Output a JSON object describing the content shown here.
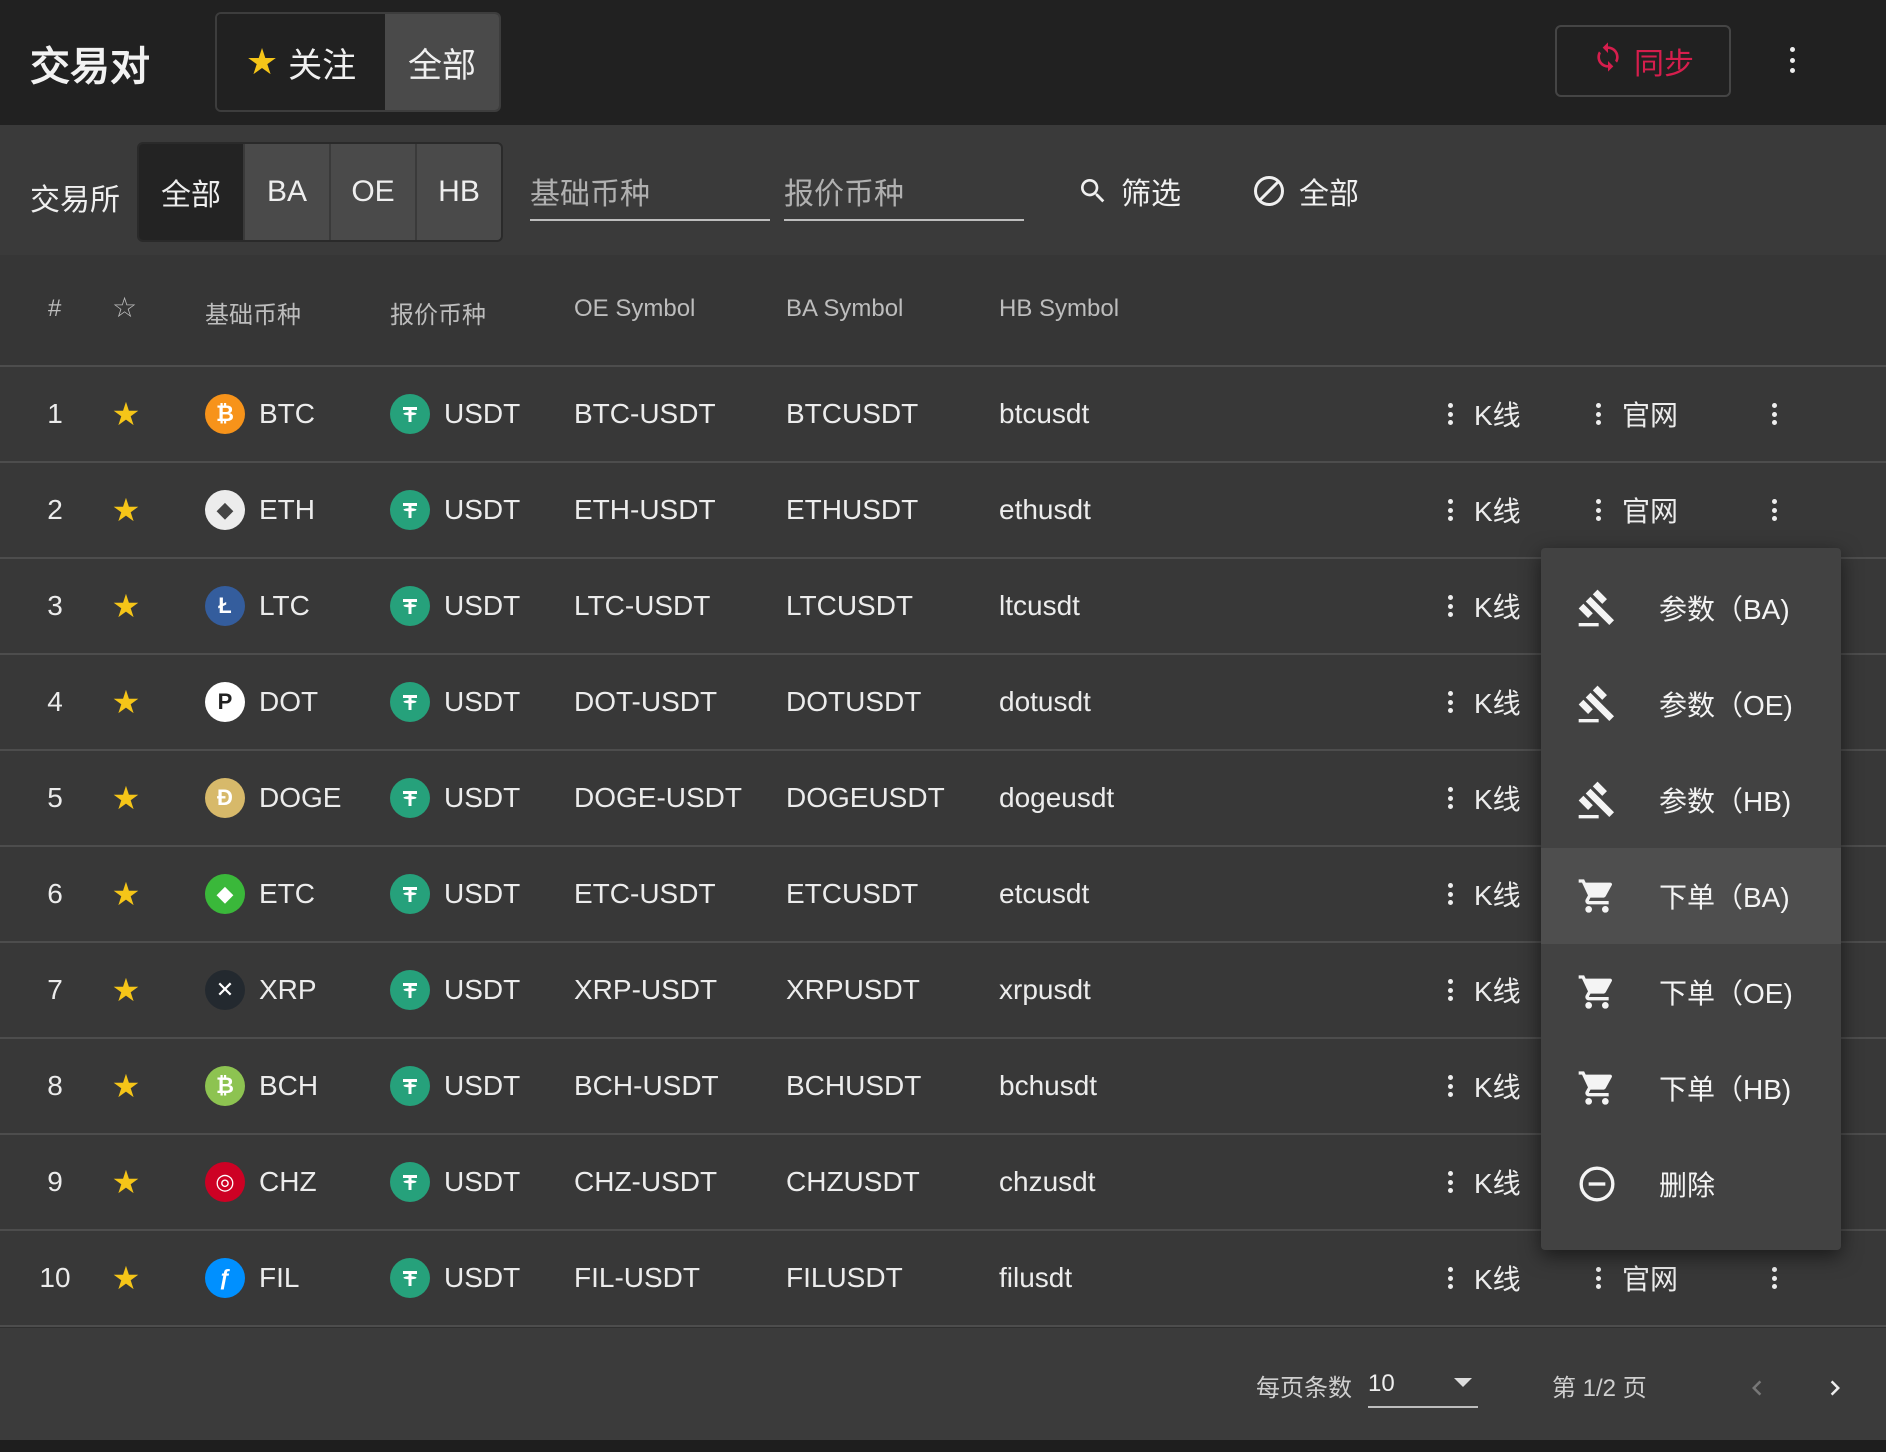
{
  "header": {
    "title": "交易对",
    "toggle_fav": "关注",
    "toggle_all": "全部",
    "sync_label": "同步"
  },
  "filters": {
    "exchange_label": "交易所",
    "exchanges": [
      "全部",
      "BA",
      "OE",
      "HB"
    ],
    "base_placeholder": "基础币种",
    "quote_placeholder": "报价币种",
    "filter_label": "筛选",
    "clear_label": "全部"
  },
  "table": {
    "columns": [
      "#",
      "☆",
      "基础币种",
      "报价币种",
      "OE Symbol",
      "BA Symbol",
      "HB Symbol"
    ],
    "kline_label": "K线",
    "site_label": "官网",
    "rows": [
      {
        "n": "1",
        "base": "BTC",
        "quote": "USDT",
        "oe": "BTC-USDT",
        "ba": "BTCUSDT",
        "hb": "btcusdt",
        "icon": "bitcoin-icon",
        "color": "#f7931a",
        "glyph": "₿"
      },
      {
        "n": "2",
        "base": "ETH",
        "quote": "USDT",
        "oe": "ETH-USDT",
        "ba": "ETHUSDT",
        "hb": "ethusdt",
        "icon": "ethereum-icon",
        "color": "#ececec",
        "glyph": "◆"
      },
      {
        "n": "3",
        "base": "LTC",
        "quote": "USDT",
        "oe": "LTC-USDT",
        "ba": "LTCUSDT",
        "hb": "ltcusdt",
        "icon": "litecoin-icon",
        "color": "#345d9d",
        "glyph": "Ł"
      },
      {
        "n": "4",
        "base": "DOT",
        "quote": "USDT",
        "oe": "DOT-USDT",
        "ba": "DOTUSDT",
        "hb": "dotusdt",
        "icon": "polkadot-icon",
        "color": "#ffffff",
        "glyph": "P"
      },
      {
        "n": "5",
        "base": "DOGE",
        "quote": "USDT",
        "oe": "DOGE-USDT",
        "ba": "DOGEUSDT",
        "hb": "dogeusdt",
        "icon": "dogecoin-icon",
        "color": "#d7b96a",
        "glyph": "Ð"
      },
      {
        "n": "6",
        "base": "ETC",
        "quote": "USDT",
        "oe": "ETC-USDT",
        "ba": "ETCUSDT",
        "hb": "etcusdt",
        "icon": "ethereum-classic-icon",
        "color": "#3ab83a",
        "glyph": "◆"
      },
      {
        "n": "7",
        "base": "XRP",
        "quote": "USDT",
        "oe": "XRP-USDT",
        "ba": "XRPUSDT",
        "hb": "xrpusdt",
        "icon": "ripple-icon",
        "color": "#23292f",
        "glyph": "✕"
      },
      {
        "n": "8",
        "base": "BCH",
        "quote": "USDT",
        "oe": "BCH-USDT",
        "ba": "BCHUSDT",
        "hb": "bchusdt",
        "icon": "bitcoin-cash-icon",
        "color": "#8dc351",
        "glyph": "₿"
      },
      {
        "n": "9",
        "base": "CHZ",
        "quote": "USDT",
        "oe": "CHZ-USDT",
        "ba": "CHZUSDT",
        "hb": "chzusdt",
        "icon": "chiliz-icon",
        "color": "#cd0124",
        "glyph": "◎"
      },
      {
        "n": "10",
        "base": "FIL",
        "quote": "USDT",
        "oe": "FIL-USDT",
        "ba": "FILUSDT",
        "hb": "filusdt",
        "icon": "filecoin-icon",
        "color": "#0090ff",
        "glyph": "ƒ"
      }
    ]
  },
  "context_menu": {
    "items": [
      {
        "label": "参数（BA)",
        "icon": "gavel-icon"
      },
      {
        "label": "参数（OE)",
        "icon": "gavel-icon"
      },
      {
        "label": "参数（HB)",
        "icon": "gavel-icon"
      },
      {
        "label": "下单（BA)",
        "icon": "cart-icon"
      },
      {
        "label": "下单（OE)",
        "icon": "cart-icon"
      },
      {
        "label": "下单（HB)",
        "icon": "cart-icon"
      },
      {
        "label": "删除",
        "icon": "minus-circle-icon"
      }
    ]
  },
  "footer": {
    "rows_per_page_label": "每页条数",
    "rows_per_page_value": "10",
    "page_info": "第 1/2 页"
  },
  "colors": {
    "accent_red": "#d61e4d",
    "star_yellow": "#f5c518",
    "usdt_green": "#26a17b"
  }
}
